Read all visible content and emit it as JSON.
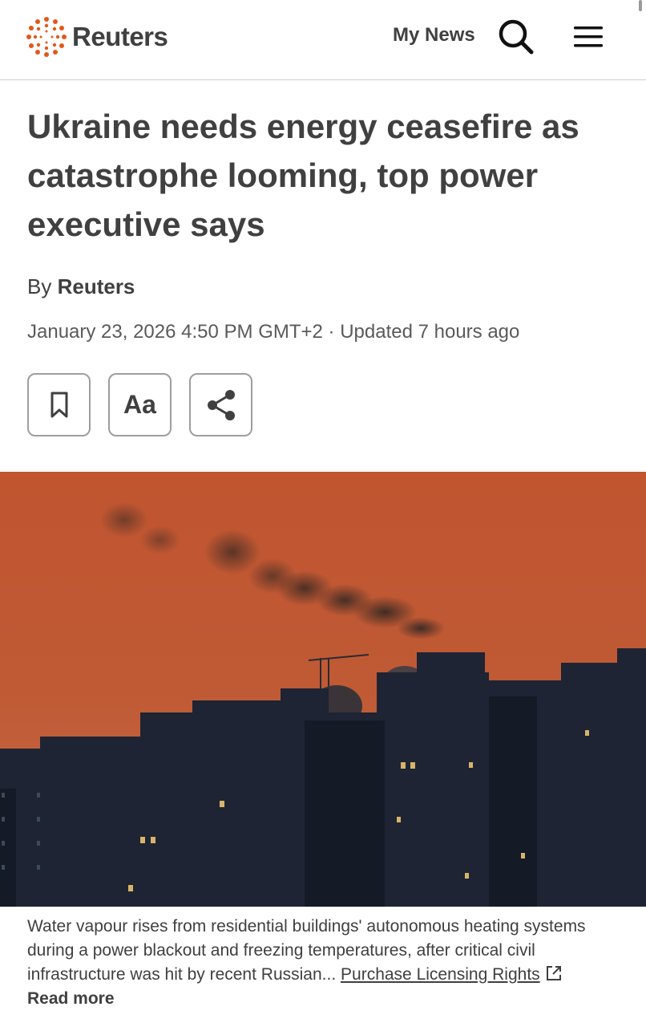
{
  "header": {
    "logo_text": "Reuters",
    "my_news_label": "My News",
    "search_icon": "search-icon",
    "menu_icon": "hamburger-menu-icon"
  },
  "article": {
    "headline": "Ukraine needs energy ceasefire as catastrophe looming, top power executive says",
    "byline_prefix": "By",
    "byline_author": "Reuters",
    "dateline": "January 23, 2026 4:50 PM GMT+2 · Updated 7 hours ago",
    "tools": {
      "bookmark_icon": "bookmark-icon",
      "text_size_label": "Aa",
      "share_icon": "share-icon"
    }
  },
  "photo": {
    "caption_text": "Water vapour rises from residential buildings' autonomous heating systems during a power blackout and freezing temperatures, after critical civil infrastructure was hit by recent Russian...",
    "license_link": "Purchase Licensing Rights",
    "read_more": "Read more"
  },
  "colors": {
    "text": "#404040",
    "brand_orange": "#e05a1c",
    "sky_top": "#b9502c",
    "sky_bottom": "#d06a3a",
    "buildings": "#1c2230"
  }
}
